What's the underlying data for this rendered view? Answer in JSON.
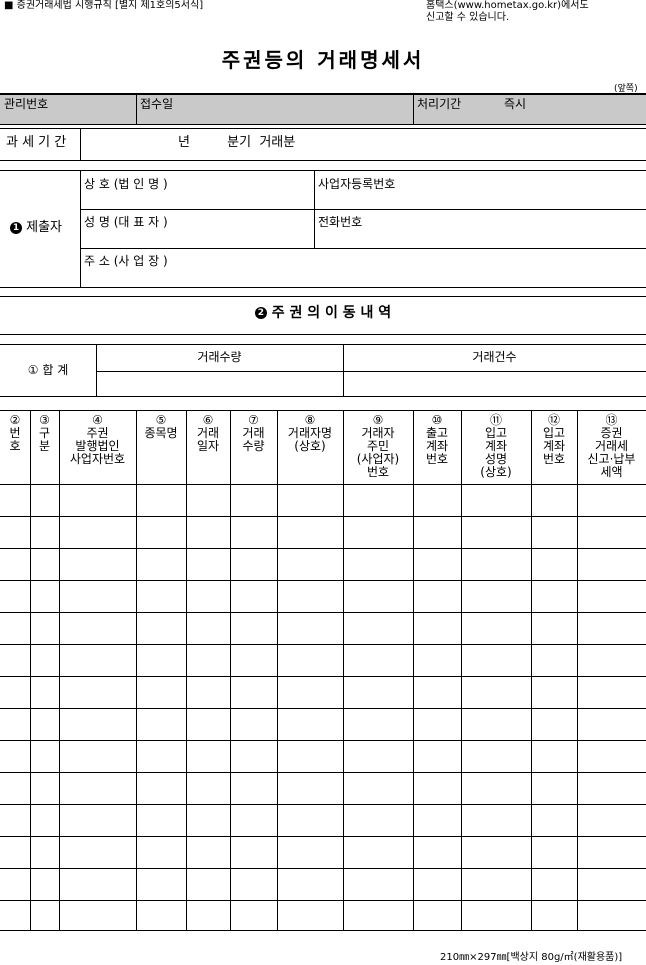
{
  "header": {
    "regulation_ref": "■ 증권거래세법 시행규칙 [별지 제1호의5서식]",
    "hometax_note": "홈택스(www.hometax.go.kr)에서도\n신고할 수 있습니다."
  },
  "form_title": "주권등의 거래명세서",
  "page_side_label": "(앞쪽)",
  "admin_row": {
    "management_no": "관리번호",
    "receipt_date": "접수일",
    "processing_period": "처리기간",
    "processing_value": "즉시"
  },
  "tax_period": {
    "label": "과 세 기 간",
    "value": "년         분기  거래분"
  },
  "submitter": {
    "section_number": "1",
    "section_label": "제출자",
    "company_name": "상 호 (법 인 명 )",
    "business_reg_no": "사업자등록번호",
    "representative": "성  명  (대  표  자 )",
    "phone": "전화번호",
    "address": "주 소 (사 업 장 )"
  },
  "movement_section": {
    "section_number": "2",
    "title": "주 권 의   이 동   내 역"
  },
  "totals": {
    "label": "① 합    계",
    "volume_label": "거래수량",
    "count_label": "거래건수"
  },
  "columns": [
    "②\n번\n호",
    "③\n구\n분",
    "④\n주권\n발행법인\n사업자번호",
    "⑤\n종목명",
    "⑥\n거래\n일자",
    "⑦\n거래\n수량",
    "⑧\n거래자명\n(상호)",
    "⑨\n거래자\n주민\n(사업자)\n번호",
    "⑩\n출고\n계좌\n번호",
    "⑪\n입고\n계좌\n성명\n(상호)",
    "⑫\n입고\n계좌\n번호",
    "⑬\n증권\n거래세\n신고·납부\n세액"
  ],
  "footer": "210㎜×297㎜[백상지 80g/㎡(재활용품)]"
}
